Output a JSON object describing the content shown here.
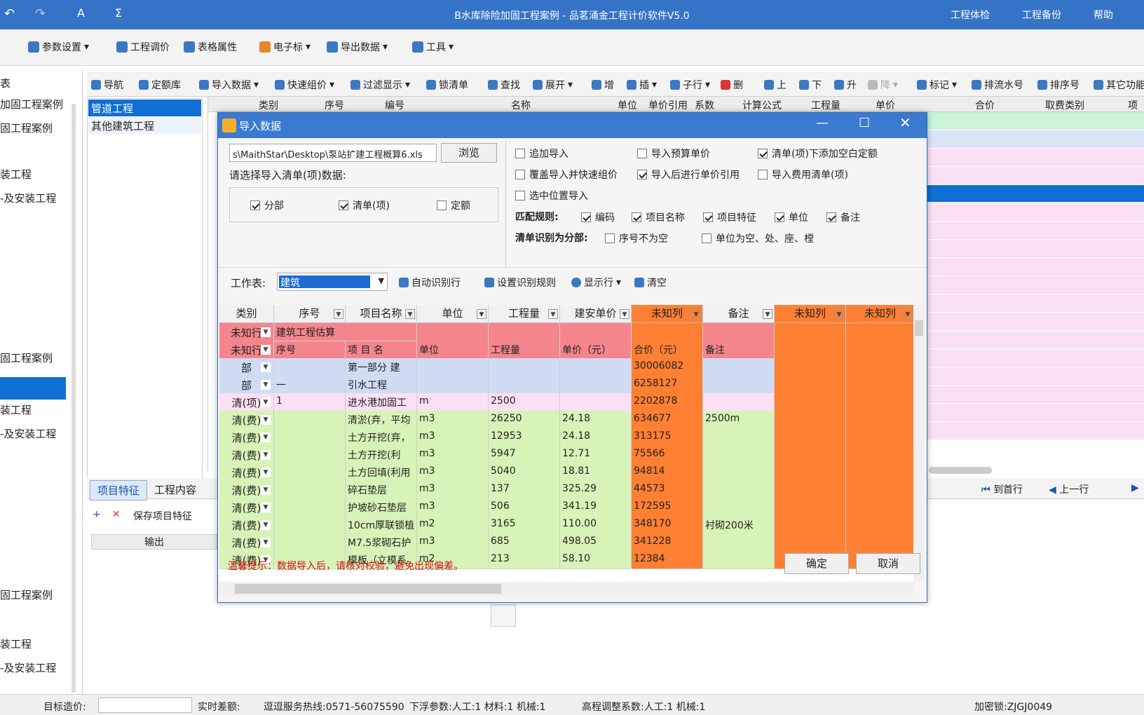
{
  "app": {
    "title": "B水库除险加固工程案例 - 品茗涌金工程计价软件V5.0",
    "top_right": [
      "工程体检",
      "工程备份",
      "帮助"
    ]
  },
  "toolbar": {
    "params": "参数设置",
    "adjust": "工程调价",
    "table_props": "表格属性",
    "ebid": "电子标",
    "export": "导出数据",
    "tools": "工具"
  },
  "left_panel": {
    "items": [
      "表",
      "加固工程案例",
      "固工程案例",
      "装工程",
      "-及安装工程",
      "固工程案例",
      "装工程",
      "-及安装工程",
      "固工程案例",
      "装工程",
      "-及安装工程"
    ]
  },
  "nav_tree": {
    "items": [
      "管道工程",
      "其他建筑工程"
    ]
  },
  "toolbar2": {
    "nav": "导航",
    "quota_lib": "定额库",
    "import": "导入数据",
    "quick_price": "快速组价",
    "filter": "过滤显示",
    "lock": "锁清单",
    "find": "查找",
    "expand": "展开",
    "add": "增",
    "insert": "插",
    "child": "子行",
    "delete": "删",
    "up": "上",
    "down": "下",
    "promote": "升",
    "demote": "降",
    "mark": "标记",
    "serial": "排流水号",
    "sort": "排序号",
    "other": "其它功能"
  },
  "grid": {
    "headers": [
      "类别",
      "序号",
      "编号",
      "名称",
      "单位",
      "单价引用",
      "系数",
      "计算公式",
      "工程量",
      "单价",
      "合价",
      "取费类别",
      "项目"
    ]
  },
  "bottom": {
    "tabs": [
      "项目特征",
      "工程内容"
    ],
    "save_label": "保存项目特征",
    "col_output": "输出",
    "first_row": "到首行",
    "prev_row": "上一行"
  },
  "dialog": {
    "title": "导入数据",
    "file_path": "s\\MaithStar\\Desktop\\泵站扩建工程概算6.xls",
    "browse": "浏览",
    "select_label": "请选择导入清单(项)数据:",
    "select_opts": [
      {
        "label": "分部",
        "checked": true
      },
      {
        "label": "清单(项)",
        "checked": true
      },
      {
        "label": "定额",
        "checked": false
      }
    ],
    "options": [
      {
        "label": "追加导入",
        "checked": false
      },
      {
        "label": "导入预算单价",
        "checked": false
      },
      {
        "label": "清单(项)下添加空白定额",
        "checked": true
      },
      {
        "label": "覆盖导入并快速组价",
        "checked": false
      },
      {
        "label": "导入后进行单价引用",
        "checked": true
      },
      {
        "label": "导入费用清单(项)",
        "checked": false
      },
      {
        "label": "选中位置导入",
        "checked": false
      }
    ],
    "match_label": "匹配规则:",
    "match_rules": [
      {
        "label": "编码",
        "checked": true
      },
      {
        "label": "项目名称",
        "checked": true
      },
      {
        "label": "项目特征",
        "checked": true
      },
      {
        "label": "单位",
        "checked": true
      },
      {
        "label": "备注",
        "checked": true
      }
    ],
    "section_label": "清单识别为分部:",
    "section_rules": [
      {
        "label": "序号不为空",
        "checked": false
      },
      {
        "label": "单位为空、处、座、樘",
        "checked": false
      }
    ],
    "sheet_label": "工作表:",
    "sheet_value": "建筑",
    "auto_identify": "自动识别行",
    "set_rules": "设置识别规则",
    "show_rows": "显示行",
    "clear": "清空",
    "columns": [
      "类别",
      "序号",
      "项目名称",
      "单位",
      "工程量",
      "建安单价",
      "未知列",
      "备注",
      "未知列",
      "未知列"
    ],
    "rows": [
      {
        "type": "未知行",
        "cells": [
          "建筑工程估算",
          "",
          "",
          "",
          "",
          "",
          "",
          "",
          ""
        ],
        "merged": true
      },
      {
        "type": "未知行",
        "cells": [
          "序号",
          "项 目 名",
          "单位",
          "工程量",
          "单价（元）",
          "合价（元）",
          "备注",
          "",
          ""
        ]
      },
      {
        "type": "部",
        "cells": [
          "",
          "第一部分 建",
          "",
          "",
          "",
          "30006082",
          "",
          "",
          ""
        ]
      },
      {
        "type": "部",
        "cells": [
          "一",
          "引水工程",
          "",
          "",
          "",
          "6258127",
          "",
          "",
          ""
        ]
      },
      {
        "type": "清(项)",
        "cells": [
          "1",
          "进水港加固工",
          "m",
          "2500",
          "",
          "2202878",
          "",
          "",
          ""
        ]
      },
      {
        "type": "清(费)",
        "cells": [
          "",
          "清淤(弃，平均",
          "m3",
          "26250",
          "24.18",
          "634677",
          "2500m",
          "",
          ""
        ]
      },
      {
        "type": "清(费)",
        "cells": [
          "",
          "土方开挖(弃，",
          "m3",
          "12953",
          "24.18",
          "313175",
          "",
          "",
          ""
        ]
      },
      {
        "type": "清(费)",
        "cells": [
          "",
          "土方开挖(利",
          "m3",
          "5947",
          "12.71",
          "75566",
          "",
          "",
          ""
        ]
      },
      {
        "type": "清(费)",
        "cells": [
          "",
          "土方回填(利用",
          "m3",
          "5040",
          "18.81",
          "94814",
          "",
          "",
          ""
        ]
      },
      {
        "type": "清(费)",
        "cells": [
          "",
          "碎石垫层",
          "m3",
          "137",
          "325.29",
          "44573",
          "",
          "",
          ""
        ]
      },
      {
        "type": "清(费)",
        "cells": [
          "",
          "护坡砂石垫层",
          "m3",
          "506",
          "341.19",
          "172595",
          "",
          "",
          ""
        ]
      },
      {
        "type": "清(费)",
        "cells": [
          "",
          "10cm厚联锁植",
          "m2",
          "3165",
          "110.00",
          "348170",
          "衬砌200米",
          "",
          ""
        ]
      },
      {
        "type": "清(费)",
        "cells": [
          "",
          "M7.5浆砌石护",
          "m3",
          "685",
          "498.05",
          "341228",
          "",
          "",
          ""
        ]
      },
      {
        "type": "清(费)",
        "cells": [
          "",
          "模板（立模系",
          "m2",
          "213",
          "58.10",
          "12384",
          "",
          "",
          ""
        ]
      }
    ],
    "hint": "温馨提示：数据导入后，请核对校验，避免出现偏差。",
    "ok": "确定",
    "cancel": "取消"
  },
  "status": {
    "target_label": "目标造价:",
    "diff_label": "实时差额:",
    "hotline": "逗逗服务热线:0571-56075590",
    "float": "下浮参数:人工:1  材料:1  机械:1",
    "adjust": "高程调整系数:人工:1  机械:1",
    "lock": "加密锁:ZJGJ0049"
  },
  "colors": {
    "accent": "#3a7ad0",
    "unknown_col": "#ff7f33",
    "unknown_row": "#f5858d",
    "part_row": "#cfdcf4",
    "list_row": "#fbe0f4",
    "fee_row": "#d8f3b8"
  }
}
